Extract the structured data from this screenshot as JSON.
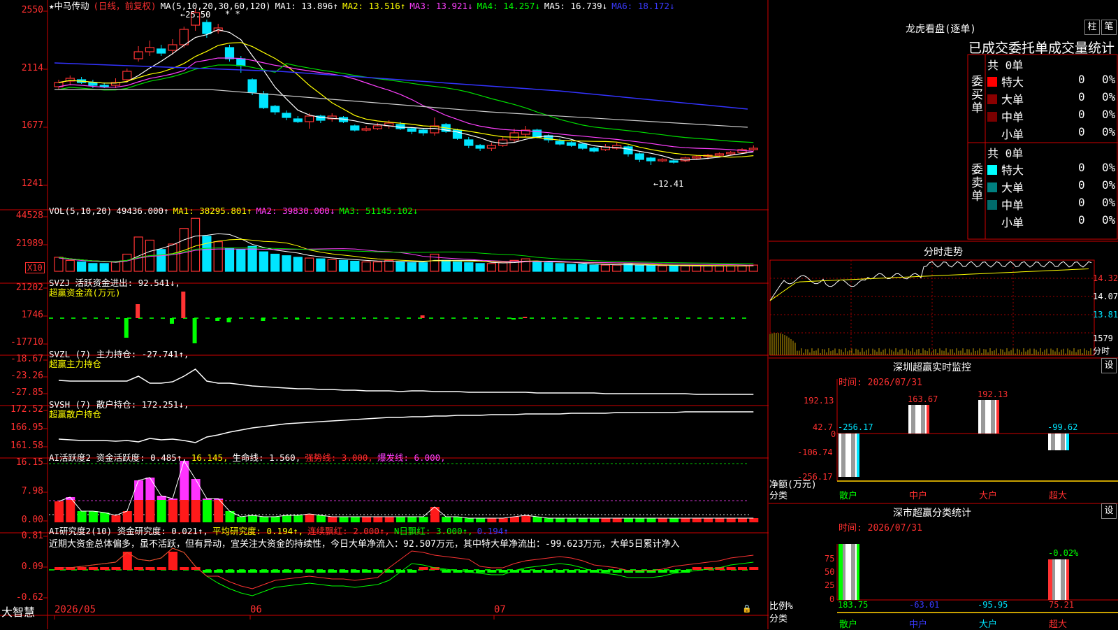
{
  "header": {
    "stock_name": "★中马传动",
    "period_info": "(日线，前复权)",
    "ma_label": "MA(5,10,20,30,60,120)",
    "ma1": "MA1: 13.896↑",
    "ma2": "MA2: 13.516↑",
    "ma3": "MA3: 13.921↓",
    "ma4": "MA4: 14.257↓",
    "ma5": "MA5: 16.739↓",
    "ma6": "MA6: 18.172↓",
    "high_mark": "←25.50",
    "low_mark": "←12.41"
  },
  "price_axis": [
    "2550",
    "2114",
    "1677",
    "1241"
  ],
  "vol": {
    "title": "VOL(5,10,20)",
    "value": "49436.000↑",
    "ma1": "MA1: 38295.801↑",
    "ma2": "MA2: 39830.000↓",
    "ma3": "MA3: 51145.102↓",
    "axis": [
      "44528",
      "21989"
    ],
    "unit": "X10"
  },
  "svzj": {
    "title": "SVZJ  活跃资金进出: 92.541↓,",
    "subtitle": "超赢资金流(万元)",
    "axis": [
      "21202",
      "1746",
      "-17710"
    ]
  },
  "svzl": {
    "title": "SVZL (7) 主力持仓: -27.741↑,",
    "subtitle": "超赢主力持仓",
    "axis": [
      "-18.67",
      "-23.26",
      "-27.85"
    ]
  },
  "svsh": {
    "title": "SVSH (7) 散户持仓: 172.251↓,",
    "subtitle": "超赢散户持仓",
    "axis": [
      "172.52",
      "166.95",
      "161.58"
    ]
  },
  "ai1": {
    "title": "AI活跃度2 资金活跃度: 0.485↑,",
    "v1": "16.145,",
    "v2": "生命线: 1.560,",
    "v3": "强势线: 3.000,",
    "v4": "爆发线: 6.000,",
    "axis": [
      "16.15",
      "7.98",
      "0.00"
    ]
  },
  "ai2": {
    "title": "AI研究度2(10) 资金研究度: 0.021↑,",
    "v1": "平均研究度: 0.194↑,",
    "v2": "连续飘红: 2.000↑,",
    "v3": "N日飘红: 3.000↑,",
    "v4": "0.194↑",
    "comment": "近期大资金总体偏多，虽不活跃，但有异动，宜关注大资金的持续性，今日大单净流入：92.507万元，其中特大单净流出：-99.623万元，大单5日累计净入",
    "axis": [
      "0.81",
      "0.09",
      "-0.62"
    ]
  },
  "footer": {
    "brand": "大智慧",
    "dates": [
      "2026/05",
      "06",
      "07"
    ]
  },
  "dragon": {
    "title": "龙虎看盘(逐单)",
    "btn1": "柱",
    "btn2": "笔",
    "subtitle": "已成交委托单成交量统计",
    "buy_label": "委买单",
    "sell_label": "委卖单",
    "buy_total": "共 0单",
    "sell_total": "共 0单",
    "buy_rows": [
      {
        "name": "特大",
        "count": "0",
        "pct": "0%",
        "color": "#ff0000"
      },
      {
        "name": "大单",
        "count": "0",
        "pct": "0%",
        "color": "#8b0000"
      },
      {
        "name": "中单",
        "count": "0",
        "pct": "0%",
        "color": "#7a0000"
      },
      {
        "name": "小单",
        "count": "0",
        "pct": "0%",
        "color": "#000000"
      }
    ],
    "sell_rows": [
      {
        "name": "特大",
        "count": "0",
        "pct": "0%",
        "color": "#00ffff"
      },
      {
        "name": "大单",
        "count": "0",
        "pct": "0%",
        "color": "#008080"
      },
      {
        "name": "中单",
        "count": "0",
        "pct": "0%",
        "color": "#006b6b"
      },
      {
        "name": "小单",
        "count": "0",
        "pct": "0%",
        "color": "#000000"
      }
    ]
  },
  "intraday": {
    "title": "分时走势",
    "axis": [
      "14.32",
      "14.07",
      "13.81"
    ],
    "vol_label": "1579",
    "vol_unit": "分时"
  },
  "sz_monitor": {
    "title": "深圳超赢实时监控",
    "btn": "设",
    "time": "时间: 2026/07/31",
    "axis": [
      "192.13",
      "42.7",
      "0",
      "-106.74",
      "-256.17"
    ],
    "bar_labels": [
      "-256.17",
      "163.67",
      "192.13",
      "-99.62"
    ],
    "net_label": "净额(万元)",
    "class_label": "分类",
    "cats": [
      "散户",
      "中户",
      "大户",
      "超大"
    ]
  },
  "sz_stats": {
    "title": "深市超赢分类统计",
    "btn": "设",
    "time": "时间: 2026/07/31",
    "axis": [
      "75",
      "50",
      "25",
      "0"
    ],
    "top_label": "-0.02%",
    "pct_label": "比例%",
    "class_label": "分类",
    "values": [
      "183.75",
      "-63.01",
      "-95.95",
      "75.21"
    ],
    "cats": [
      "散户",
      "中户",
      "大户",
      "超大"
    ]
  }
}
